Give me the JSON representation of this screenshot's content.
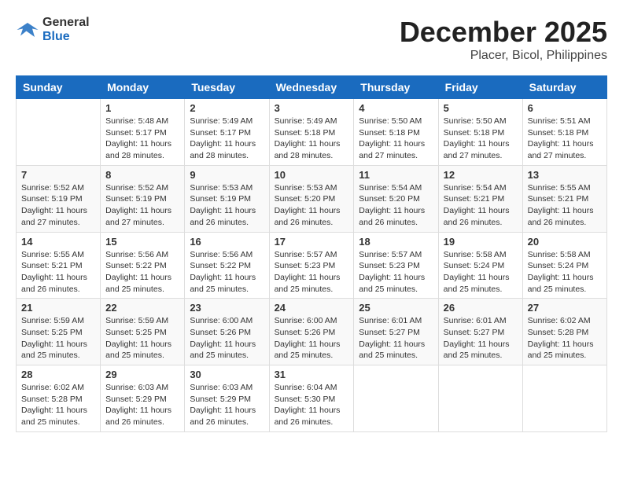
{
  "header": {
    "logo": {
      "general": "General",
      "blue": "Blue"
    },
    "title": "December 2025",
    "location": "Placer, Bicol, Philippines"
  },
  "weekdays": [
    "Sunday",
    "Monday",
    "Tuesday",
    "Wednesday",
    "Thursday",
    "Friday",
    "Saturday"
  ],
  "weeks": [
    [
      {
        "day": "",
        "info": ""
      },
      {
        "day": "1",
        "info": "Sunrise: 5:48 AM\nSunset: 5:17 PM\nDaylight: 11 hours and 28 minutes."
      },
      {
        "day": "2",
        "info": "Sunrise: 5:49 AM\nSunset: 5:17 PM\nDaylight: 11 hours and 28 minutes."
      },
      {
        "day": "3",
        "info": "Sunrise: 5:49 AM\nSunset: 5:18 PM\nDaylight: 11 hours and 28 minutes."
      },
      {
        "day": "4",
        "info": "Sunrise: 5:50 AM\nSunset: 5:18 PM\nDaylight: 11 hours and 27 minutes."
      },
      {
        "day": "5",
        "info": "Sunrise: 5:50 AM\nSunset: 5:18 PM\nDaylight: 11 hours and 27 minutes."
      },
      {
        "day": "6",
        "info": "Sunrise: 5:51 AM\nSunset: 5:18 PM\nDaylight: 11 hours and 27 minutes."
      }
    ],
    [
      {
        "day": "7",
        "info": "Sunrise: 5:52 AM\nSunset: 5:19 PM\nDaylight: 11 hours and 27 minutes."
      },
      {
        "day": "8",
        "info": "Sunrise: 5:52 AM\nSunset: 5:19 PM\nDaylight: 11 hours and 27 minutes."
      },
      {
        "day": "9",
        "info": "Sunrise: 5:53 AM\nSunset: 5:19 PM\nDaylight: 11 hours and 26 minutes."
      },
      {
        "day": "10",
        "info": "Sunrise: 5:53 AM\nSunset: 5:20 PM\nDaylight: 11 hours and 26 minutes."
      },
      {
        "day": "11",
        "info": "Sunrise: 5:54 AM\nSunset: 5:20 PM\nDaylight: 11 hours and 26 minutes."
      },
      {
        "day": "12",
        "info": "Sunrise: 5:54 AM\nSunset: 5:21 PM\nDaylight: 11 hours and 26 minutes."
      },
      {
        "day": "13",
        "info": "Sunrise: 5:55 AM\nSunset: 5:21 PM\nDaylight: 11 hours and 26 minutes."
      }
    ],
    [
      {
        "day": "14",
        "info": "Sunrise: 5:55 AM\nSunset: 5:21 PM\nDaylight: 11 hours and 26 minutes."
      },
      {
        "day": "15",
        "info": "Sunrise: 5:56 AM\nSunset: 5:22 PM\nDaylight: 11 hours and 25 minutes."
      },
      {
        "day": "16",
        "info": "Sunrise: 5:56 AM\nSunset: 5:22 PM\nDaylight: 11 hours and 25 minutes."
      },
      {
        "day": "17",
        "info": "Sunrise: 5:57 AM\nSunset: 5:23 PM\nDaylight: 11 hours and 25 minutes."
      },
      {
        "day": "18",
        "info": "Sunrise: 5:57 AM\nSunset: 5:23 PM\nDaylight: 11 hours and 25 minutes."
      },
      {
        "day": "19",
        "info": "Sunrise: 5:58 AM\nSunset: 5:24 PM\nDaylight: 11 hours and 25 minutes."
      },
      {
        "day": "20",
        "info": "Sunrise: 5:58 AM\nSunset: 5:24 PM\nDaylight: 11 hours and 25 minutes."
      }
    ],
    [
      {
        "day": "21",
        "info": "Sunrise: 5:59 AM\nSunset: 5:25 PM\nDaylight: 11 hours and 25 minutes."
      },
      {
        "day": "22",
        "info": "Sunrise: 5:59 AM\nSunset: 5:25 PM\nDaylight: 11 hours and 25 minutes."
      },
      {
        "day": "23",
        "info": "Sunrise: 6:00 AM\nSunset: 5:26 PM\nDaylight: 11 hours and 25 minutes."
      },
      {
        "day": "24",
        "info": "Sunrise: 6:00 AM\nSunset: 5:26 PM\nDaylight: 11 hours and 25 minutes."
      },
      {
        "day": "25",
        "info": "Sunrise: 6:01 AM\nSunset: 5:27 PM\nDaylight: 11 hours and 25 minutes."
      },
      {
        "day": "26",
        "info": "Sunrise: 6:01 AM\nSunset: 5:27 PM\nDaylight: 11 hours and 25 minutes."
      },
      {
        "day": "27",
        "info": "Sunrise: 6:02 AM\nSunset: 5:28 PM\nDaylight: 11 hours and 25 minutes."
      }
    ],
    [
      {
        "day": "28",
        "info": "Sunrise: 6:02 AM\nSunset: 5:28 PM\nDaylight: 11 hours and 25 minutes."
      },
      {
        "day": "29",
        "info": "Sunrise: 6:03 AM\nSunset: 5:29 PM\nDaylight: 11 hours and 26 minutes."
      },
      {
        "day": "30",
        "info": "Sunrise: 6:03 AM\nSunset: 5:29 PM\nDaylight: 11 hours and 26 minutes."
      },
      {
        "day": "31",
        "info": "Sunrise: 6:04 AM\nSunset: 5:30 PM\nDaylight: 11 hours and 26 minutes."
      },
      {
        "day": "",
        "info": ""
      },
      {
        "day": "",
        "info": ""
      },
      {
        "day": "",
        "info": ""
      }
    ]
  ]
}
